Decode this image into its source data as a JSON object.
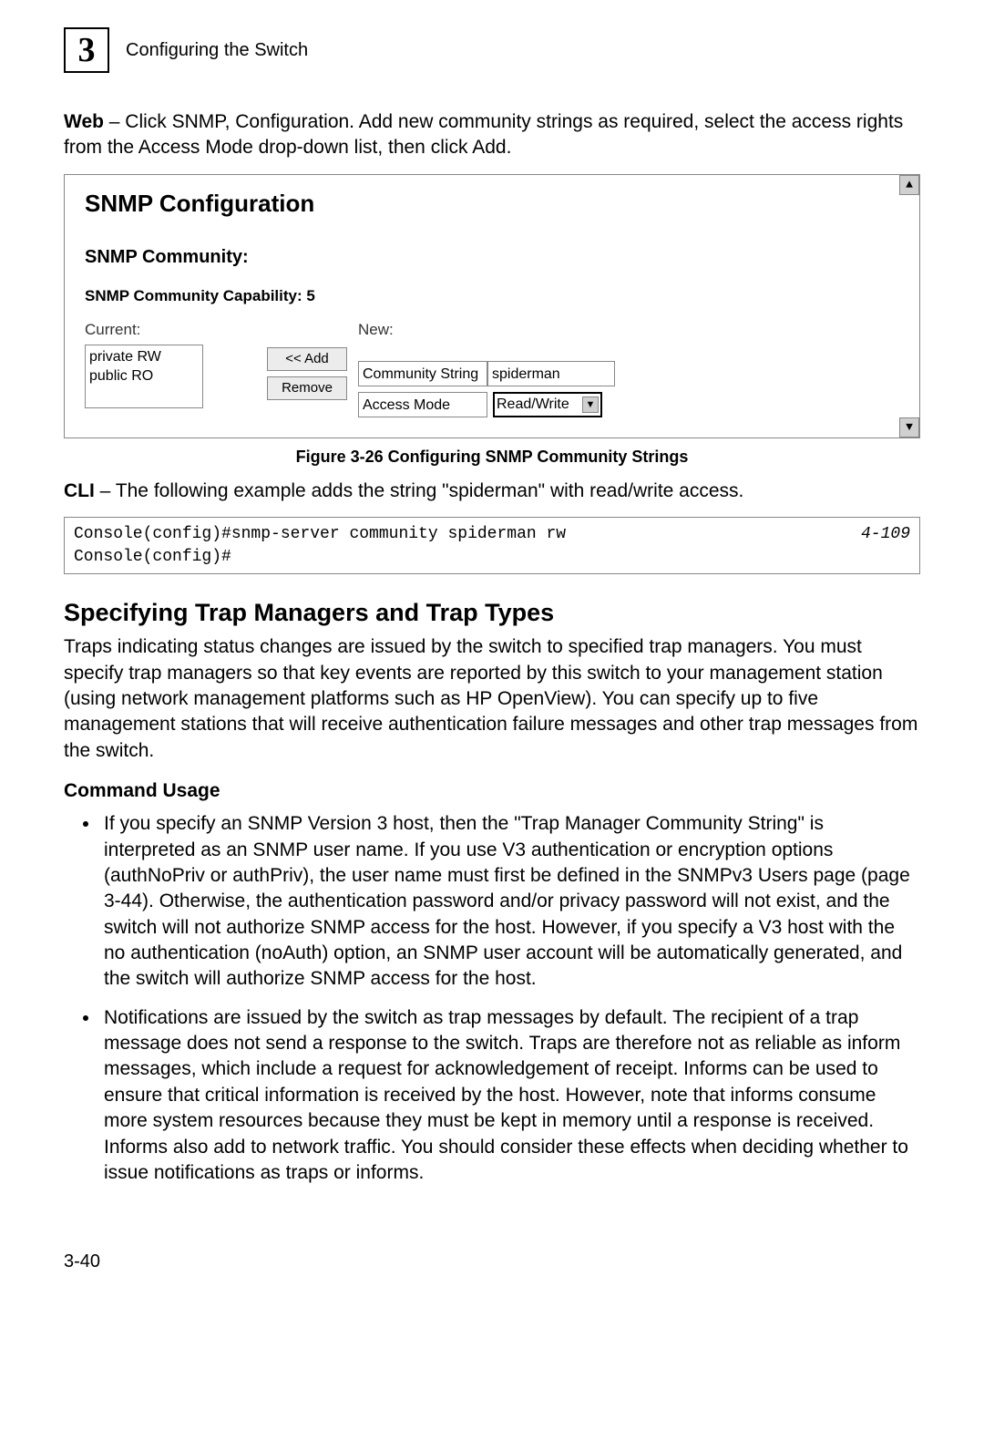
{
  "header": {
    "chapter_number": "3",
    "chapter_title": "Configuring the Switch"
  },
  "intro": {
    "web_label": "Web",
    "web_text": " – Click SNMP, Configuration. Add new community strings as required, select the access rights from the Access Mode drop-down list, then click Add."
  },
  "figure": {
    "title": "SNMP Configuration",
    "community_label": "SNMP Community:",
    "capability_label": "SNMP Community Capability: 5",
    "current_label": "Current:",
    "current_items": "private RW\npublic RO",
    "add_btn": "<< Add",
    "remove_btn": "Remove",
    "new_label": "New:",
    "cs_label": "Community String",
    "cs_value": "spiderman",
    "am_label": "Access Mode",
    "am_value": "Read/Write",
    "scroll_up": "▲",
    "scroll_down": "▼",
    "caption": "Figure 3-26   Configuring SNMP Community Strings"
  },
  "cli": {
    "label": "CLI",
    "text": " – The following example adds the string \"spiderman\" with read/write access.",
    "code": "Console(config)#snmp-server community spiderman rw\nConsole(config)#",
    "ref": "4-109"
  },
  "section": {
    "heading": "Specifying Trap Managers and Trap Types",
    "para": "Traps indicating status changes are issued by the switch to specified trap managers. You must specify trap managers so that key events are reported by this switch to your management station (using network management platforms such as HP OpenView). You can specify up to five management stations that will receive authentication failure messages and other trap messages from the switch.",
    "usage_label": "Command Usage",
    "bullet1": "If you specify an SNMP Version 3 host, then the \"Trap Manager Community String\" is interpreted as an SNMP user name. If you use V3 authentication or encryption options (authNoPriv or authPriv), the user name must first be defined in the SNMPv3 Users page (page 3-44). Otherwise, the authentication password and/or privacy password will not exist, and the switch will not authorize SNMP access for the host. However, if you specify a V3 host with the no authentication (noAuth) option, an SNMP user account will be automatically generated, and the switch will authorize SNMP access for the host.",
    "bullet2": "Notifications are issued by the switch as trap messages by default. The recipient of a trap message does not send a response to the switch. Traps are therefore not as reliable as inform messages, which include a request for acknowledgement of receipt. Informs can be used to ensure that critical information is received by the host. However, note that informs consume more system resources because they must be kept in memory until a response is received. Informs also add to network traffic. You should consider these effects when deciding whether to issue notifications as traps or informs."
  },
  "footer": {
    "page": "3-40"
  }
}
